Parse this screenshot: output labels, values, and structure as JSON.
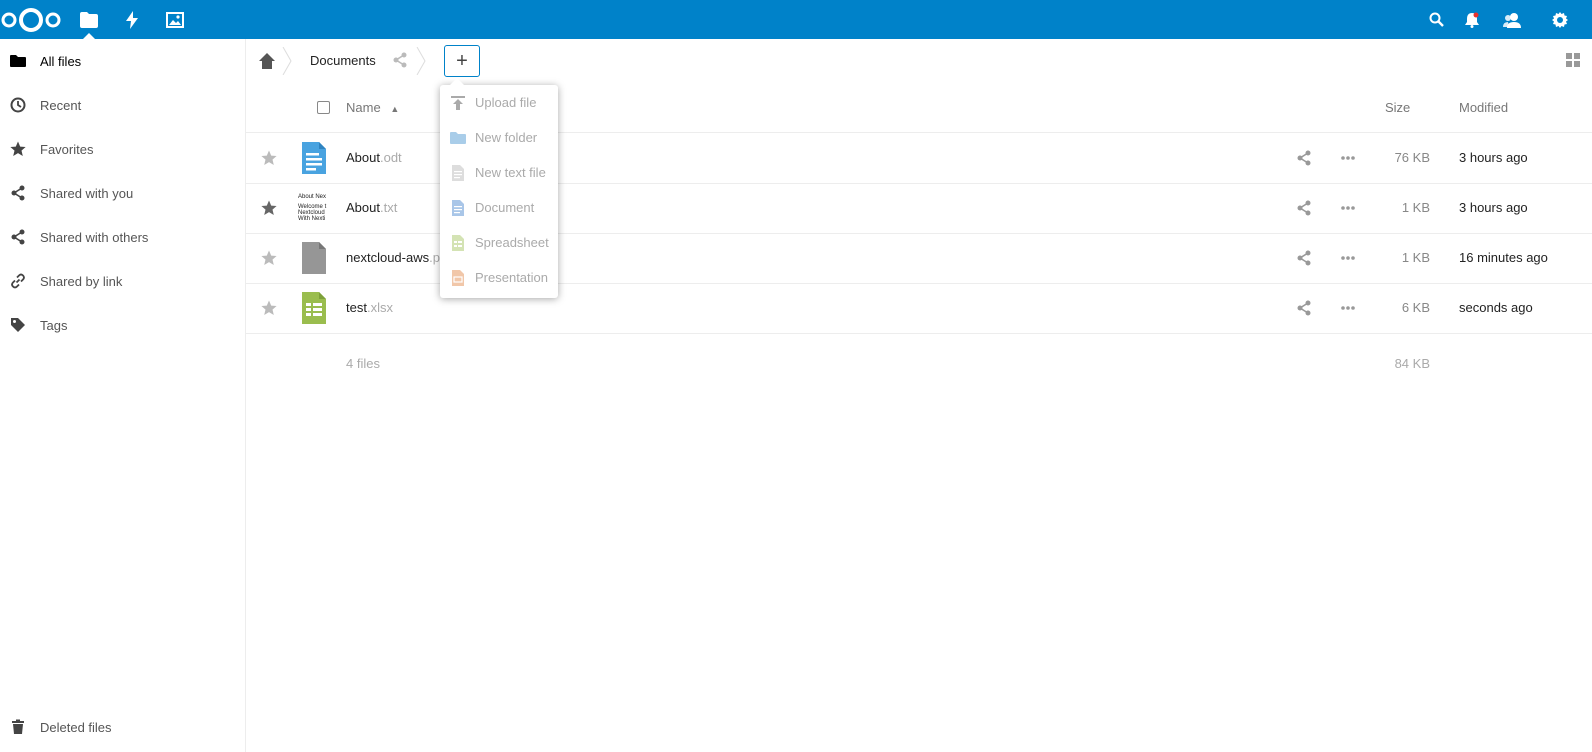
{
  "header": {
    "apps": [
      {
        "name": "folder-icon",
        "label": "Files"
      },
      {
        "name": "activity-icon",
        "label": "Activity"
      },
      {
        "name": "gallery-icon",
        "label": "Gallery"
      }
    ]
  },
  "sidebar": {
    "items": [
      {
        "label": "All files",
        "icon": "folder-icon"
      },
      {
        "label": "Recent",
        "icon": "clock-icon"
      },
      {
        "label": "Favorites",
        "icon": "star-icon"
      },
      {
        "label": "Shared with you",
        "icon": "share-icon"
      },
      {
        "label": "Shared with others",
        "icon": "share-icon"
      },
      {
        "label": "Shared by link",
        "icon": "link-icon"
      },
      {
        "label": "Tags",
        "icon": "tag-icon"
      }
    ],
    "deleted": {
      "label": "Deleted files",
      "icon": "trash-icon"
    }
  },
  "breadcrumb": {
    "current": "Documents",
    "new_label": "+"
  },
  "table": {
    "headers": {
      "name": "Name",
      "size": "Size",
      "modified": "Modified"
    },
    "rows": [
      {
        "base": "About",
        "ext": ".odt",
        "size": "76 KB",
        "modified": "3 hours ago",
        "type": "document"
      },
      {
        "base": "About",
        "ext": ".txt",
        "size": "1 KB",
        "modified": "3 hours ago",
        "type": "text"
      },
      {
        "base": "nextcloud-aws",
        "ext": ".p",
        "size": "1 KB",
        "modified": "16 minutes ago",
        "type": "generic"
      },
      {
        "base": "test",
        "ext": ".xlsx",
        "size": "6 KB",
        "modified": "seconds ago",
        "type": "spreadsheet"
      }
    ],
    "txt_thumb_lines": [
      "About Nex",
      "Welcome t",
      "Nextcloud",
      "With Nexti"
    ],
    "summary": {
      "files": "4 files",
      "size": "84 KB"
    }
  },
  "new_menu": {
    "items": [
      {
        "label": "Upload file",
        "icon": "upload-icon"
      },
      {
        "label": "New folder",
        "icon": "folder-icon"
      },
      {
        "label": "New text file",
        "icon": "text-file-icon"
      },
      {
        "label": "Document",
        "icon": "document-icon"
      },
      {
        "label": "Spreadsheet",
        "icon": "spreadsheet-icon"
      },
      {
        "label": "Presentation",
        "icon": "presentation-icon"
      }
    ]
  },
  "colors": {
    "header_bg": "#0082c9",
    "doc_blue": "#49a3e0",
    "sheet_green": "#9abd4e",
    "generic_gray": "#969696"
  }
}
